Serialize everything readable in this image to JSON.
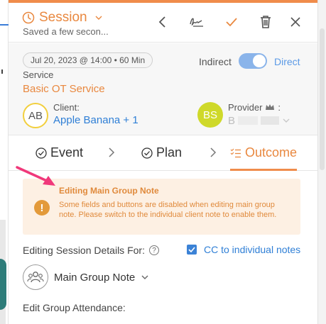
{
  "header": {
    "title": "Session",
    "subtitle": "Saved a few secon..."
  },
  "info": {
    "date_chip": "Jul 20, 2023 @ 14:00 • 60 Min",
    "indirect_label": "Indirect",
    "direct_label": "Direct",
    "toggle_state": "direct",
    "service_label": "Service",
    "service_value": "Basic OT Service",
    "client": {
      "label": "Client:",
      "initials": "AB",
      "value": "Apple Banana + 1"
    },
    "provider": {
      "label": "Provider",
      "colon": ":",
      "initials": "BS",
      "value_initial": "B"
    }
  },
  "tabs": [
    {
      "label": "Event"
    },
    {
      "label": "Plan"
    },
    {
      "label": "Outcome",
      "active": true
    }
  ],
  "alert": {
    "title": "Editing Main Group Note",
    "body": "Some fields and buttons are disabled when editing main group note. Please switch to the individual client note to enable them."
  },
  "edit_section": {
    "label": "Editing Session Details For:",
    "cc_label": "CC to individual notes",
    "cc_checked": true,
    "group_select": "Main Group Note",
    "attendance_label": "Edit Group Attendance:"
  },
  "colors": {
    "accent_orange": "#f08c4b",
    "link_blue": "#2f7fd6",
    "alert_bg": "#fdf0e3",
    "arrow_pink": "#f0387a"
  }
}
